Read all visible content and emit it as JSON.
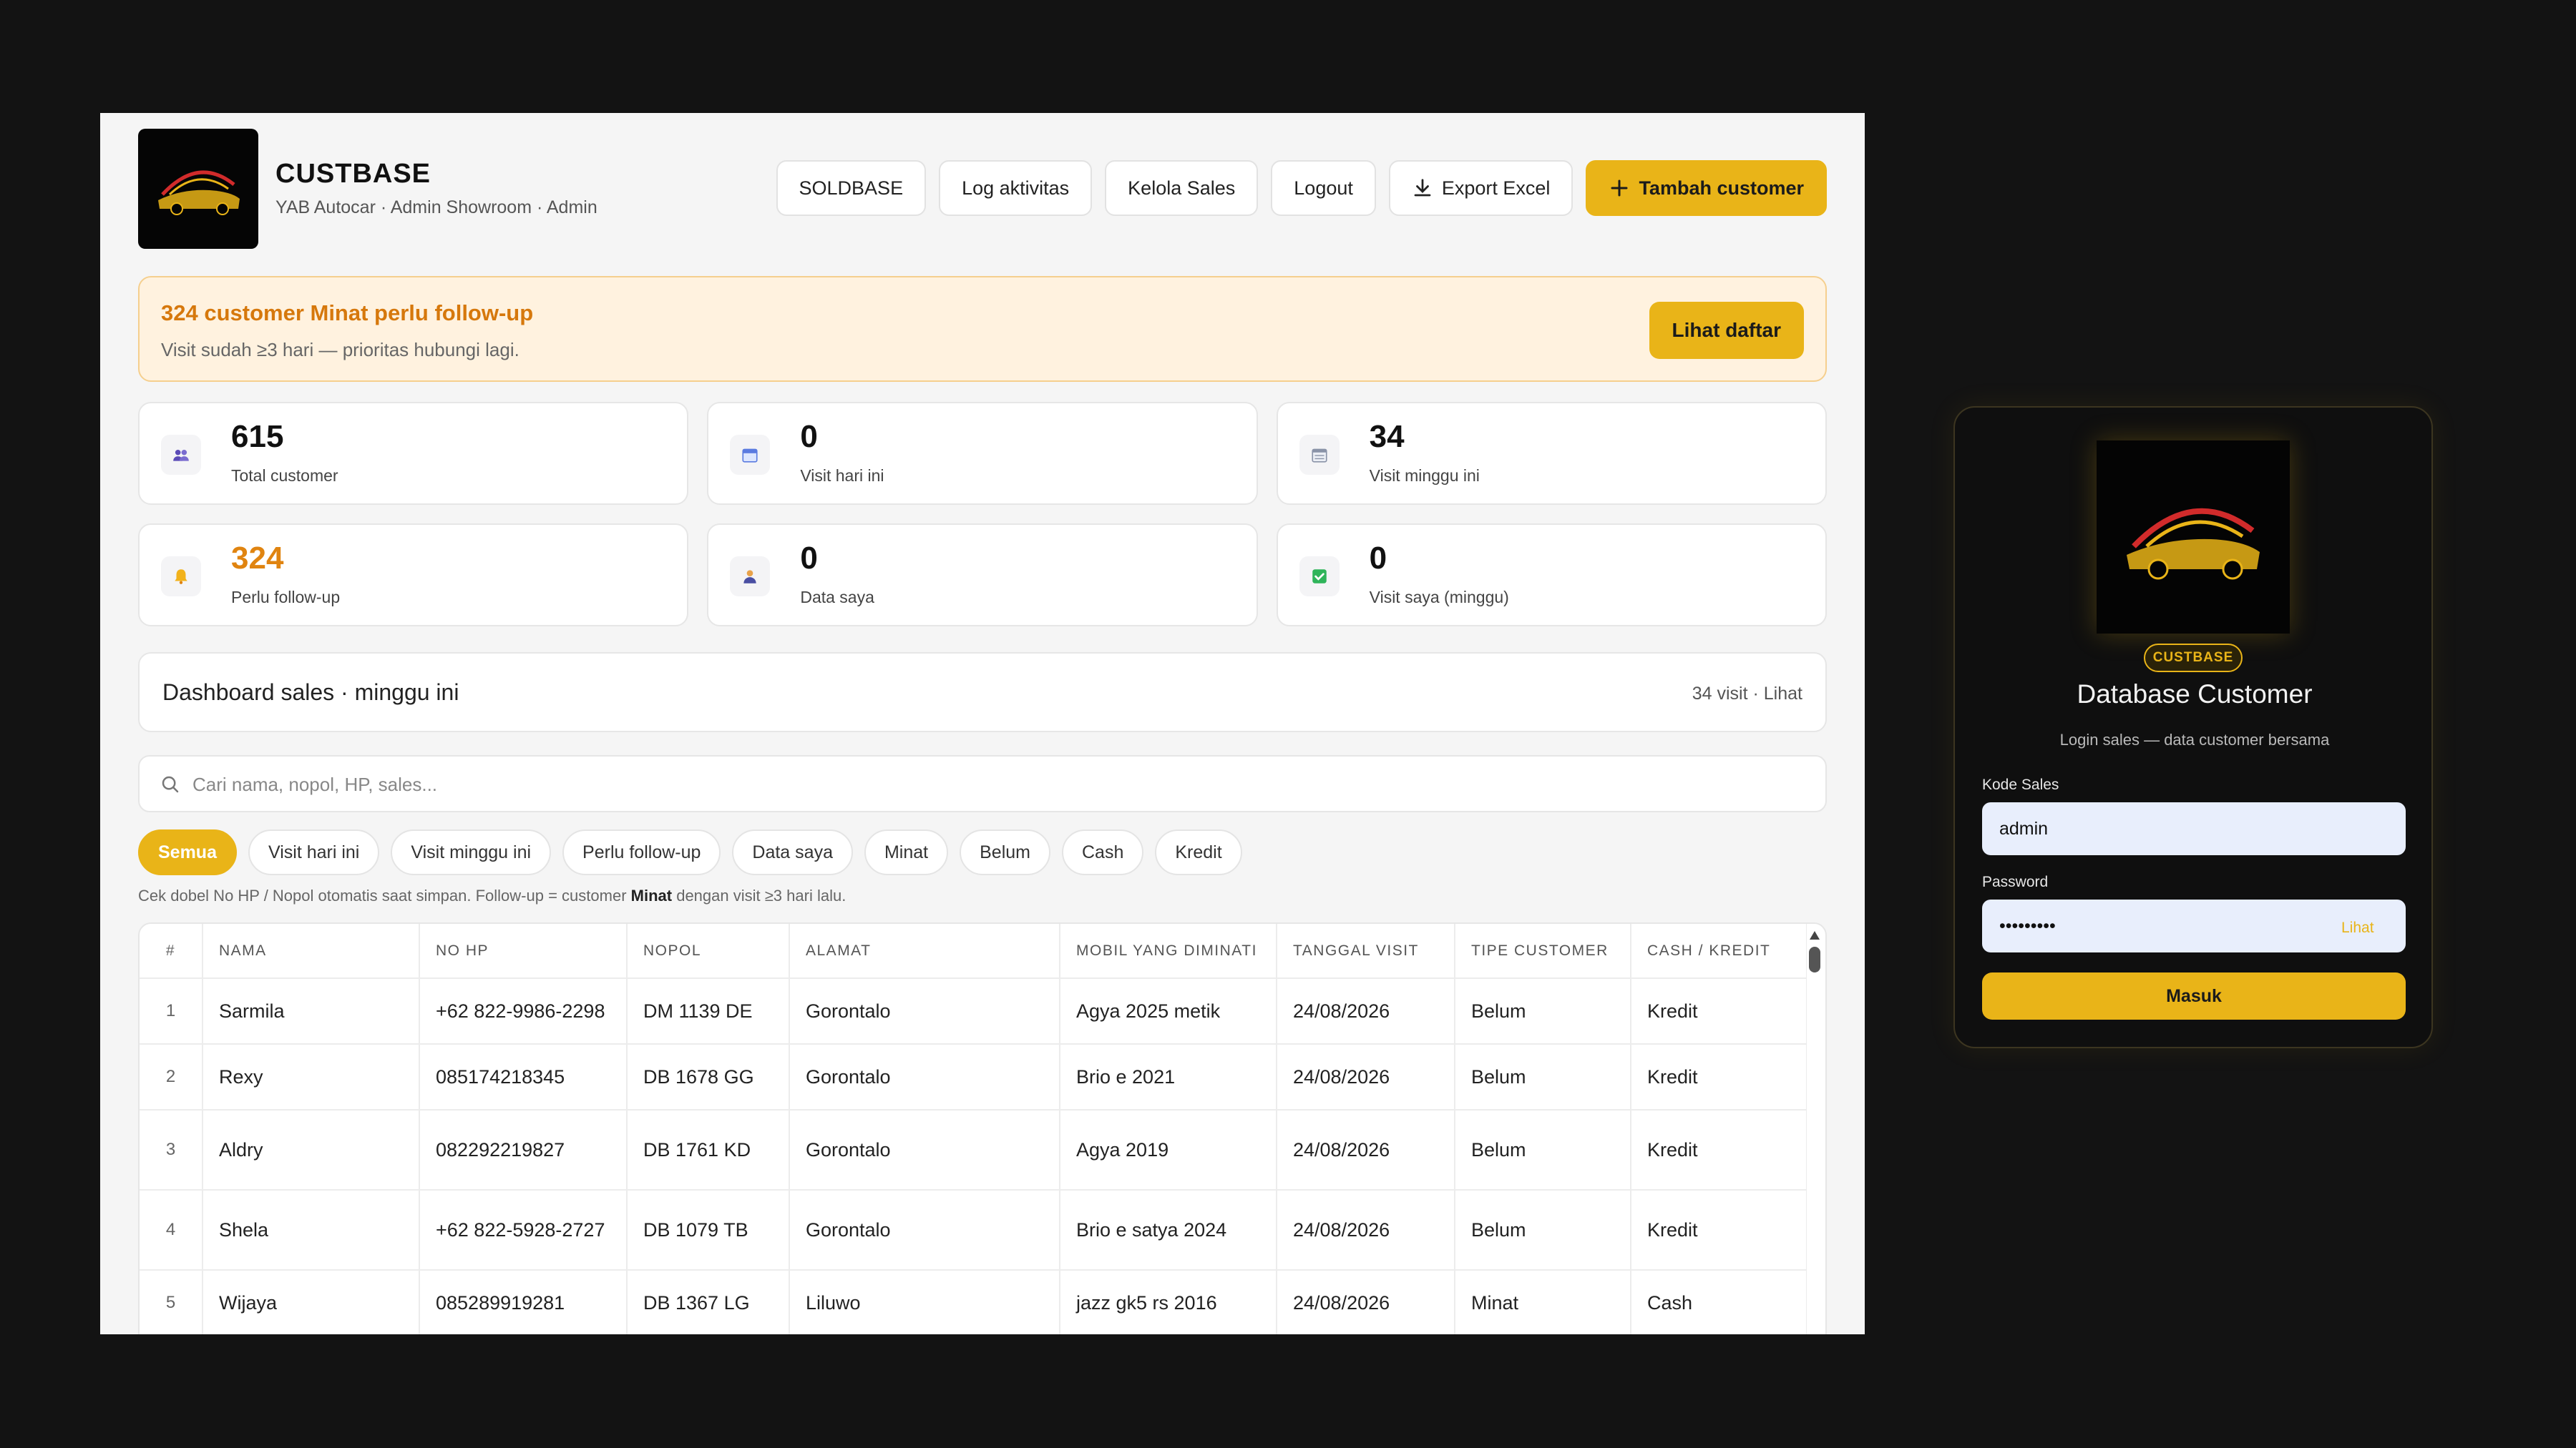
{
  "app": {
    "title": "CUSTBASE",
    "subtitle": "YAB Autocar · Admin Showroom · Admin",
    "logo_text": "YAB AUTOCAR"
  },
  "header_buttons": {
    "soldbase": "SOLDBASE",
    "log": "Log aktivitas",
    "kelola": "Kelola Sales",
    "logout": "Logout",
    "export": "Export Excel",
    "tambah": "Tambah customer"
  },
  "alert": {
    "title": "324 customer Minat perlu follow-up",
    "subtitle": "Visit sudah ≥3 hari — prioritas hubungi lagi.",
    "button": "Lihat daftar"
  },
  "stats": [
    {
      "value": "615",
      "label": "Total customer",
      "icon": "users-icon"
    },
    {
      "value": "0",
      "label": "Visit hari ini",
      "icon": "calendar-icon"
    },
    {
      "value": "34",
      "label": "Visit minggu ini",
      "icon": "calendar-week-icon"
    },
    {
      "value": "324",
      "label": "Perlu follow-up",
      "icon": "bell-icon"
    },
    {
      "value": "0",
      "label": "Data saya",
      "icon": "person-icon"
    },
    {
      "value": "0",
      "label": "Visit saya (minggu)",
      "icon": "check-square-icon"
    }
  ],
  "dashboard": {
    "title": "Dashboard sales · minggu ini",
    "right": "34 visit · Lihat"
  },
  "search": {
    "placeholder": "Cari nama, nopol, HP, sales..."
  },
  "filters": [
    "Semua",
    "Visit hari ini",
    "Visit minggu ini",
    "Perlu follow-up",
    "Data saya",
    "Minat",
    "Belum",
    "Cash",
    "Kredit"
  ],
  "note": {
    "before": "Cek dobel No HP / Nopol otomatis saat simpan. Follow-up = customer ",
    "bold": "Minat",
    "after": " dengan visit ≥3 hari lalu."
  },
  "table": {
    "headers": [
      "#",
      "NAMA",
      "NO HP",
      "NOPOL",
      "ALAMAT",
      "MOBIL YANG DIMINATI",
      "TANGGAL VISIT",
      "TIPE CUSTOMER",
      "CASH / KREDIT"
    ],
    "rows": [
      [
        "1",
        "Sarmila",
        "+62 822-9986-2298",
        "DM 1139 DE",
        "Gorontalo",
        "Agya 2025 metik",
        "24/08/2026",
        "Belum",
        "Kredit"
      ],
      [
        "2",
        "Rexy",
        "085174218345",
        "DB 1678 GG",
        "Gorontalo",
        "Brio e 2021",
        "24/08/2026",
        "Belum",
        "Kredit"
      ],
      [
        "3",
        "Aldry",
        "082292219827",
        "DB 1761 KD",
        "Gorontalo",
        "Agya 2019",
        "24/08/2026",
        "Belum",
        "Kredit"
      ],
      [
        "4",
        "Shela",
        "+62 822-5928-2727",
        "DB 1079 TB",
        "Gorontalo",
        "Brio e satya 2024",
        "24/08/2026",
        "Belum",
        "Kredit"
      ],
      [
        "5",
        "Wijaya",
        "085289919281",
        "DB 1367 LG",
        "Liluwo",
        "jazz gk5 rs 2016",
        "24/08/2026",
        "Minat",
        "Cash"
      ]
    ]
  },
  "login": {
    "badge": "CUSTBASE",
    "title": "Database Customer",
    "subtitle": "Login sales — data customer bersama",
    "kode_label": "Kode Sales",
    "kode_value": "admin",
    "password_label": "Password",
    "password_value": "•••••••••",
    "show_label": "Lihat",
    "submit": "Masuk"
  },
  "colors": {
    "accent": "#e9b418",
    "alert_text": "#d6780c",
    "alert_bg": "#fff2df",
    "page_bg": "#131313"
  }
}
